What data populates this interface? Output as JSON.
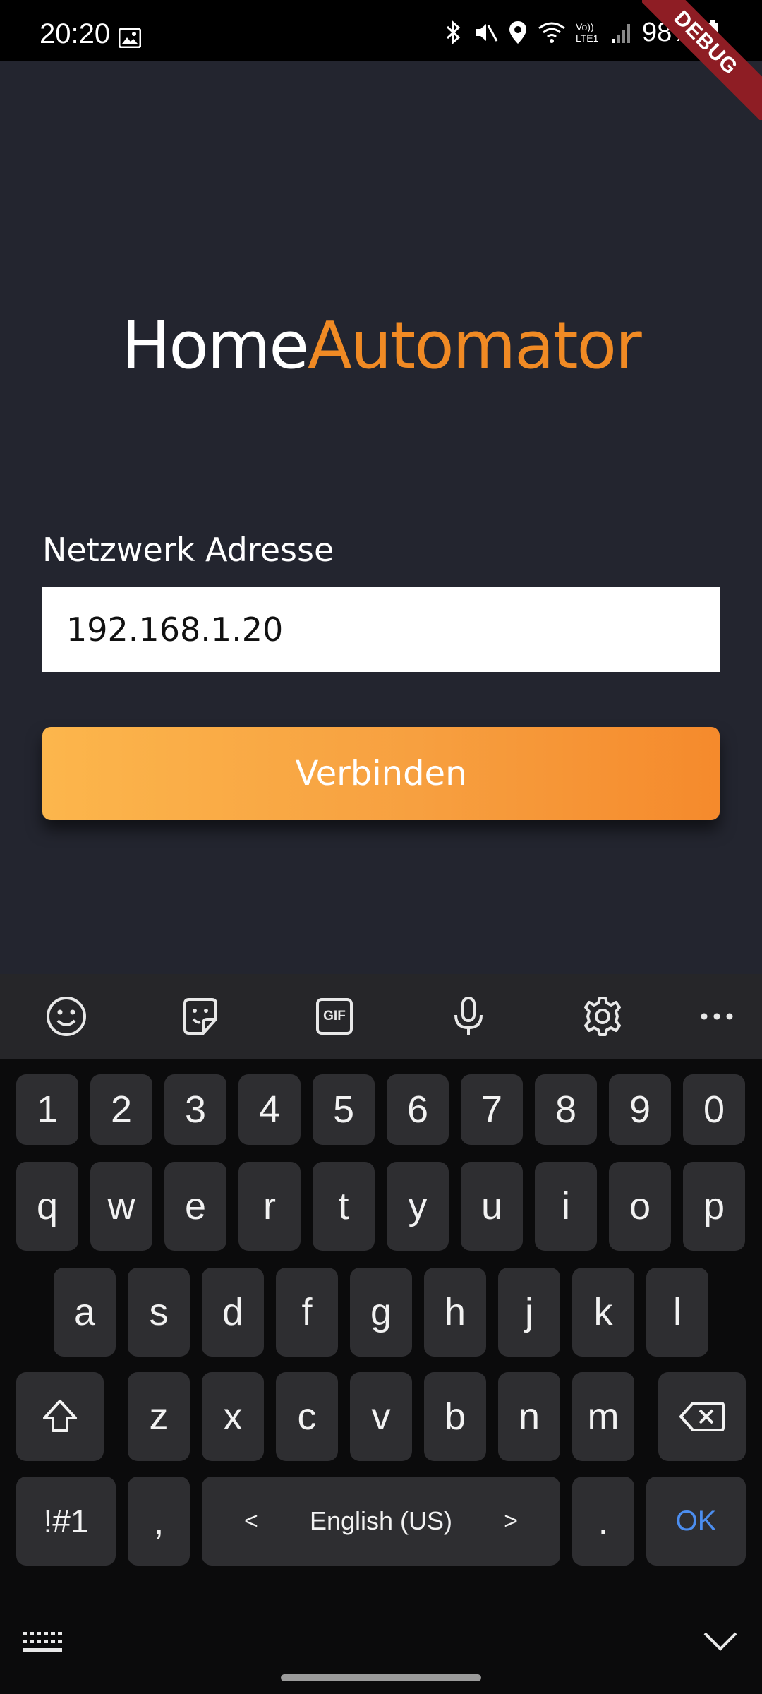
{
  "status_bar": {
    "time": "20:20",
    "battery": "98%",
    "debug_banner": "DEBUG",
    "network_label": "Vo)) LTE1"
  },
  "app": {
    "title_part1": "Home",
    "title_part2": "Automator",
    "address_label": "Netzwerk Adresse",
    "address_value": "192.168.1.20",
    "connect_label": "Verbinden",
    "colors": {
      "background": "#23252f",
      "accent": "#f08a24",
      "button_start": "#fcb64c",
      "button_end": "#f58a2c"
    }
  },
  "keyboard": {
    "toolbar_icons": [
      "emoji-icon",
      "sticker-icon",
      "gif-icon",
      "microphone-icon",
      "settings-icon",
      "more-icon"
    ],
    "gif_label": "GIF",
    "number_row": [
      "1",
      "2",
      "3",
      "4",
      "5",
      "6",
      "7",
      "8",
      "9",
      "0"
    ],
    "row_q": [
      "q",
      "w",
      "e",
      "r",
      "t",
      "y",
      "u",
      "i",
      "o",
      "p"
    ],
    "row_a": [
      "a",
      "s",
      "d",
      "f",
      "g",
      "h",
      "j",
      "k",
      "l"
    ],
    "row_z": [
      "z",
      "x",
      "c",
      "v",
      "b",
      "n",
      "m"
    ],
    "symbols_label": "!#1",
    "comma_label": ",",
    "space_label": "English (US)",
    "space_left": "<",
    "space_right": ">",
    "period_label": ".",
    "ok_label": "OK"
  }
}
